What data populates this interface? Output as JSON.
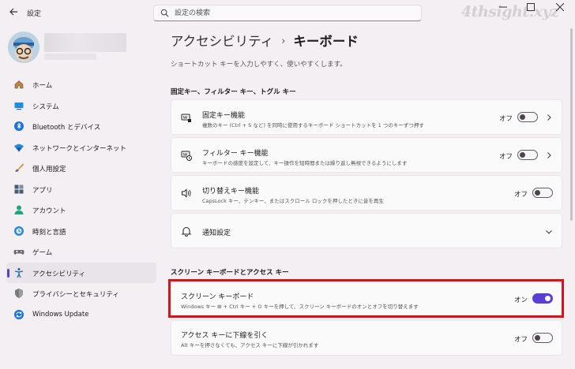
{
  "window": {
    "title": "設定",
    "watermark": "4thsight.xyz"
  },
  "search": {
    "placeholder": "設定の検索"
  },
  "sidebar": {
    "items": [
      {
        "label": "ホーム",
        "icon": "home-icon"
      },
      {
        "label": "システム",
        "icon": "system-icon"
      },
      {
        "label": "Bluetooth とデバイス",
        "icon": "bluetooth-icon"
      },
      {
        "label": "ネットワークとインターネット",
        "icon": "network-icon"
      },
      {
        "label": "個人用設定",
        "icon": "brush-icon"
      },
      {
        "label": "アプリ",
        "icon": "apps-icon"
      },
      {
        "label": "アカウント",
        "icon": "account-icon"
      },
      {
        "label": "時刻と言語",
        "icon": "time-language-icon"
      },
      {
        "label": "ゲーム",
        "icon": "game-icon"
      },
      {
        "label": "アクセシビリティ",
        "icon": "accessibility-icon",
        "active": true
      },
      {
        "label": "プライバシーとセキュリティ",
        "icon": "shield-icon"
      },
      {
        "label": "Windows Update",
        "icon": "windows-update-icon"
      }
    ]
  },
  "main": {
    "breadcrumb": {
      "parent": "アクセシビリティ",
      "separator": "›",
      "current": "キーボード"
    },
    "description": "ショートカット キーを入力しやすく、使いやすくします。",
    "section1": {
      "title": "固定キー、フィルター キー、トグル キー",
      "cards": [
        {
          "title": "固定キー機能",
          "desc": "複数のキー (Ctrl + S など) を同時に使用するキーボード ショートカットを 1 つのキーずつ押す",
          "toggle": "オフ",
          "on": false
        },
        {
          "title": "フィルター キー機能",
          "desc": "キーボードの感度を設定して、キー操作を短時間または繰り返し無視できるようにします",
          "toggle": "オフ",
          "on": false
        },
        {
          "title": "切り替えキー機能",
          "desc": "CapsLock キー、テンキー、またはスクロール ロックを押したときに音を再生",
          "toggle": "オフ",
          "on": false
        },
        {
          "title": "通知設定"
        }
      ]
    },
    "section2": {
      "title": "スクリーン キーボードとアクセス キー",
      "cards": [
        {
          "title": "スクリーン キーボード",
          "desc": "Windows キー ⊞ + Ctrl キー + O キーを押して、スクリーン キーボードのオンとオフを切り替えます",
          "toggle": "オン",
          "on": true
        },
        {
          "title": "アクセス キーに下線を引く",
          "desc": "Alt キーを押さなくても、アクセス キーに下線が引かれます",
          "toggle": "オフ",
          "on": false
        }
      ]
    }
  },
  "colors": {
    "accent": "#5b3fd4",
    "highlight": "#d9121c"
  }
}
